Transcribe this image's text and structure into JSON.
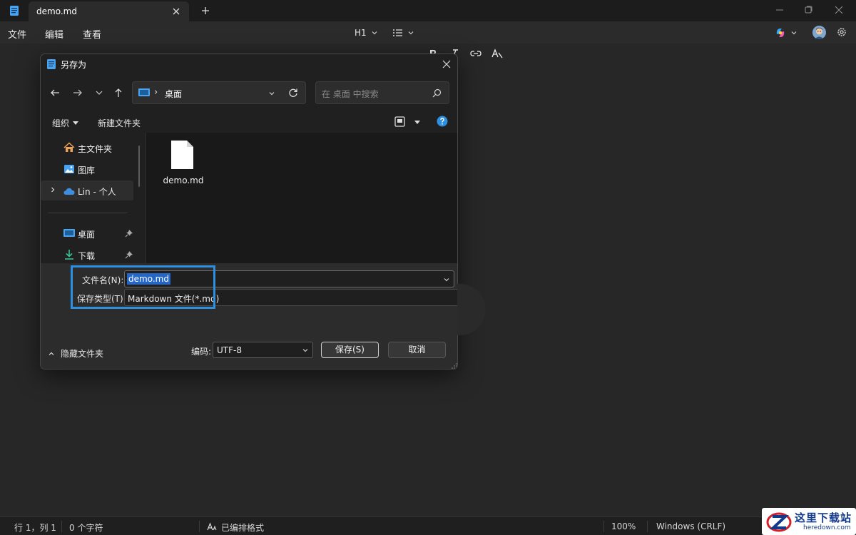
{
  "window": {
    "tab_title": "demo.md",
    "app_icon": "notepad-icon",
    "controls": [
      "minimize-icon",
      "maximize-icon",
      "close-icon"
    ]
  },
  "menu": {
    "file": "文件",
    "edit": "编辑",
    "view": "查看"
  },
  "toolbar": {
    "heading_label": "H1",
    "icons": [
      "list-icon",
      "bold-icon",
      "italic-icon",
      "link-icon",
      "clear-format-icon",
      "copilot-icon",
      "avatar",
      "gear-icon"
    ]
  },
  "dialog": {
    "title": "另存为",
    "address": {
      "separator": "›",
      "location": "桌面"
    },
    "search_placeholder": "在 桌面 中搜索",
    "commands": {
      "organize": "组织",
      "new_folder": "新建文件夹"
    },
    "nav_items": [
      {
        "label": "主文件夹",
        "icon": "home-icon"
      },
      {
        "label": "图库",
        "icon": "gallery-icon"
      },
      {
        "label": "Lin - 个人",
        "icon": "onedrive-icon",
        "selected": true
      },
      {
        "label": "桌面",
        "icon": "desktop-icon",
        "pinned": true
      },
      {
        "label": "下载",
        "icon": "download-icon",
        "pinned": true
      }
    ],
    "files": [
      {
        "name": "demo.md",
        "icon": "file-icon"
      }
    ],
    "filename_label": "文件名(N):",
    "filename_value": "demo.md",
    "filetype_label": "保存类型(T):",
    "filetype_value": "Markdown 文件(*.md)",
    "hide_folders": "隐藏文件夹",
    "encoding_label": "编码:",
    "encoding_value": "UTF-8",
    "save_button": "保存(S)",
    "cancel_button": "取消",
    "highlight_color": "#2d8fe0"
  },
  "status": {
    "position": "行 1，列 1",
    "chars": "0 个字符",
    "format": "已编排格式",
    "zoom": "100%",
    "line_ending": "Windows (CRLF)"
  },
  "watermark": {
    "title": "这里下载站",
    "url": "heredown.com"
  }
}
